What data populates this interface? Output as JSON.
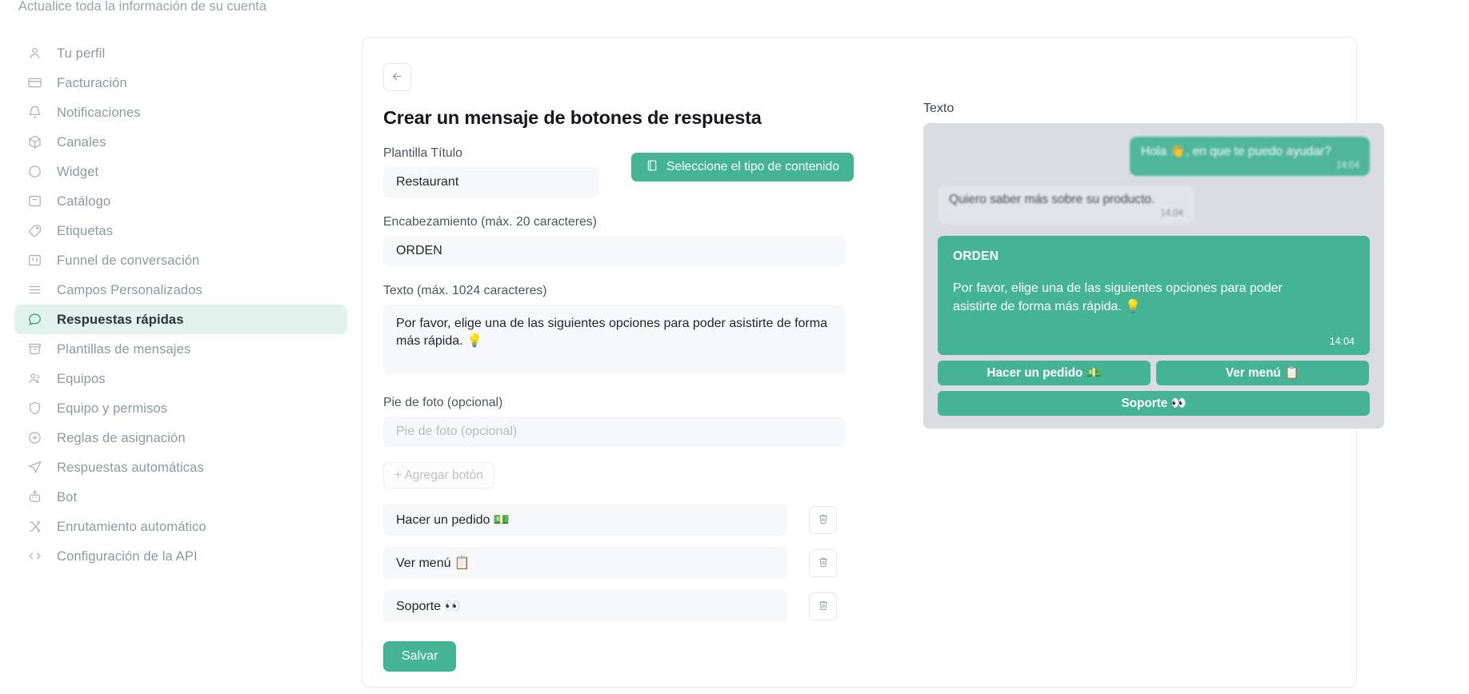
{
  "sidebar": {
    "subtitle": "Actualice toda la información de su cuenta",
    "items": [
      {
        "label": "Tu perfil",
        "icon": "user-icon",
        "active": false
      },
      {
        "label": "Facturación",
        "icon": "credit-card-icon",
        "active": false
      },
      {
        "label": "Notificaciones",
        "icon": "bell-icon",
        "active": false
      },
      {
        "label": "Canales",
        "icon": "box-icon",
        "active": false
      },
      {
        "label": "Widget",
        "icon": "circle-icon",
        "active": false
      },
      {
        "label": "Catálogo",
        "icon": "bag-icon",
        "active": false
      },
      {
        "label": "Etiquetas",
        "icon": "tag-icon",
        "active": false
      },
      {
        "label": "Funnel de conversación",
        "icon": "kanban-icon",
        "active": false
      },
      {
        "label": "Campos Personalizados",
        "icon": "lines-icon",
        "active": false
      },
      {
        "label": "Respuestas rápidas",
        "icon": "chat-bubble-icon",
        "active": true
      },
      {
        "label": "Plantillas de mensajes",
        "icon": "archive-icon",
        "active": false
      },
      {
        "label": "Equipos",
        "icon": "users-icon",
        "active": false
      },
      {
        "label": "Equipo y permisos",
        "icon": "shield-icon",
        "active": false
      },
      {
        "label": "Reglas de asignación",
        "icon": "plus-circle-icon",
        "active": false
      },
      {
        "label": "Respuestas automáticas",
        "icon": "send-icon",
        "active": false
      },
      {
        "label": "Bot",
        "icon": "robot-icon",
        "active": false
      },
      {
        "label": "Enrutamiento automático",
        "icon": "shuffle-icon",
        "active": false
      },
      {
        "label": "Configuración de la API",
        "icon": "code-icon",
        "active": false
      }
    ]
  },
  "form": {
    "back_label": "←",
    "title": "Crear un mensaje de botones de respuesta",
    "template_title_label": "Plantilla Título",
    "template_title_value": "Restaurant",
    "select_content_label": "Seleccione el tipo de contenido",
    "heading_label": "Encabezamiento (máx. 20 caracteres)",
    "heading_value": "ORDEN",
    "text_label": "Texto (máx. 1024 caracteres)",
    "text_value": "Por favor, elige una de las siguientes opciones para poder asistirte de forma más rápida. 💡",
    "caption_label": "Pie de foto (opcional)",
    "caption_value": "",
    "caption_placeholder": "Pie de foto (opcional)",
    "add_button_label": "+ Agregar botón",
    "buttons": [
      {
        "value": "Hacer un pedido 💵"
      },
      {
        "value": "Ver menú 📋"
      },
      {
        "value": "Soporte 👀"
      }
    ],
    "save_label": "Salvar"
  },
  "preview": {
    "label": "Texto",
    "messages": [
      {
        "direction": "out",
        "text": "Hola 👋, en que te puedo ayudar?",
        "time": "14:04"
      },
      {
        "direction": "in",
        "text": "Quiero saber más sobre su producto.",
        "time": "14:04"
      }
    ],
    "template": {
      "header": "ORDEN",
      "body": "Por favor, elige una de las siguientes opciones para poder asistirte de forma más rápida. 💡",
      "time": "14:04",
      "buttons": [
        {
          "label": "Hacer un pedido 💵",
          "width": "half"
        },
        {
          "label": "Ver menú 📋",
          "width": "half"
        },
        {
          "label": "Soporte 👀",
          "width": "full"
        }
      ]
    }
  },
  "colors": {
    "accent_green": "#45b495",
    "active_nav_bg": "#e2f2ec",
    "field_bg": "#f7f8f9",
    "phone_bg": "#d9dce0"
  }
}
